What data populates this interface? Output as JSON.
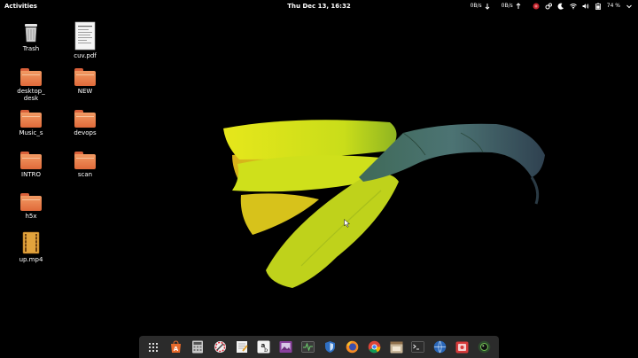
{
  "topbar": {
    "activities_label": "Activities",
    "clock": "Thu Dec 13, 16:32",
    "net_down": "0B/s",
    "net_up": "0B/s",
    "battery": "74 %"
  },
  "desktop": {
    "icons": [
      {
        "label": "Trash"
      },
      {
        "label": "cuv.pdf"
      },
      {
        "label": "desktop_\ndesk"
      },
      {
        "label": "NEW"
      },
      {
        "label": "Music_s"
      },
      {
        "label": "devops"
      },
      {
        "label": "INTRO"
      },
      {
        "label": "scan"
      },
      {
        "label": "h5x"
      },
      {
        "label": "up.mp4"
      }
    ]
  },
  "dock": {
    "apps": [
      "show-apps-icon",
      "software-center-icon",
      "calculator-icon",
      "settings-tweaks-icon",
      "text-editor-icon",
      "dictionary-icon",
      "image-viewer-icon",
      "system-monitor-icon",
      "shield-icon",
      "firefox-icon",
      "chrome-icon",
      "file-manager-icon",
      "terminal-icon",
      "network-icon",
      "screenshot-icon",
      "camera-icon"
    ]
  },
  "colors": {
    "folder": "#e8773f",
    "dock_bg": "#2b2b2b",
    "petal": "#d4e21a"
  }
}
